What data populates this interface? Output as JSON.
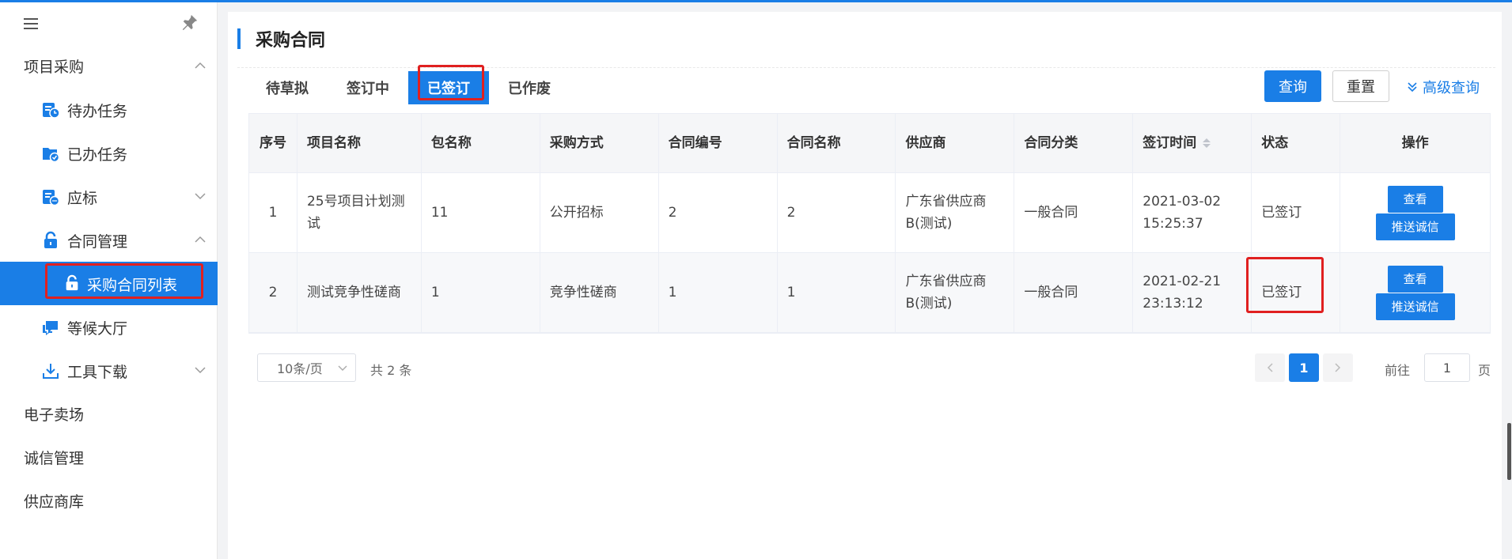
{
  "sidebar": {
    "menu": [
      {
        "label": "项目采购",
        "level": 1,
        "expanded": true
      },
      {
        "label": "待办任务",
        "level": 2,
        "icon": "task-list-clock-icon"
      },
      {
        "label": "已办任务",
        "level": 2,
        "icon": "folder-check-icon"
      },
      {
        "label": "应标",
        "level": 2,
        "icon": "bid-list-icon",
        "expanded": false
      },
      {
        "label": "合同管理",
        "level": 2,
        "icon": "lock-icon",
        "expanded": true
      },
      {
        "label": "采购合同列表",
        "level": 3,
        "icon": "lock-icon",
        "active": true
      },
      {
        "label": "等候大厅",
        "level": 2,
        "icon": "chat-icon"
      },
      {
        "label": "工具下载",
        "level": 2,
        "icon": "download-icon",
        "expanded": false
      },
      {
        "label": "电子卖场",
        "level": 1
      },
      {
        "label": "诚信管理",
        "level": 1
      },
      {
        "label": "供应商库",
        "level": 1
      }
    ]
  },
  "page": {
    "title": "采购合同",
    "tabs": [
      "待草拟",
      "签订中",
      "已签订",
      "已作废"
    ],
    "active_tab": "已签订",
    "buttons": {
      "query": "查询",
      "reset": "重置",
      "advanced": "高级查询"
    }
  },
  "table": {
    "columns": [
      "序号",
      "项目名称",
      "包名称",
      "采购方式",
      "合同编号",
      "合同名称",
      "供应商",
      "合同分类",
      "签订时间",
      "状态",
      "操作"
    ],
    "rows": [
      {
        "no": "1",
        "project": "25号项目计划测试",
        "package": "11",
        "method": "公开招标",
        "contract_no": "2",
        "contract_name": "2",
        "supplier": "广东省供应商B(测试)",
        "category": "一般合同",
        "signed_at": "2021-03-02 15:25:37",
        "status": "已签订",
        "ops": [
          "查看",
          "推送诚信"
        ]
      },
      {
        "no": "2",
        "project": "测试竞争性磋商",
        "package": "1",
        "method": "竞争性磋商",
        "contract_no": "1",
        "contract_name": "1",
        "supplier": "广东省供应商B(测试)",
        "category": "一般合同",
        "signed_at": "2021-02-21 23:13:12",
        "status": "已签订",
        "ops": [
          "查看",
          "推送诚信"
        ]
      }
    ]
  },
  "pagination": {
    "page_size": "10条/页",
    "total": "共 2 条",
    "current": "1",
    "goto_prefix": "前往",
    "goto_value": "1",
    "goto_suffix": "页"
  },
  "colors": {
    "accent": "#1a7ee6",
    "highlight": "#e02020"
  }
}
